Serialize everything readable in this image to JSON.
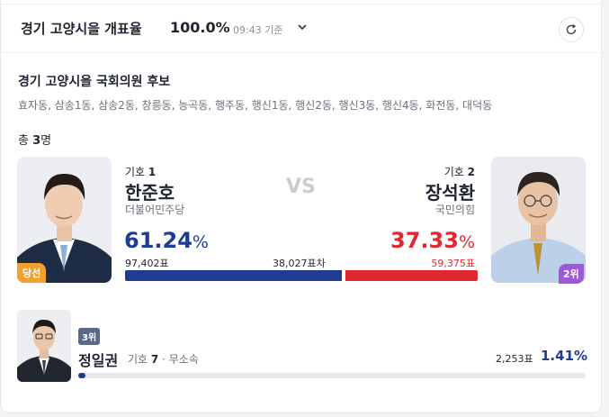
{
  "header": {
    "title": "경기 고양시을 개표율",
    "percent": "100.0%",
    "time": "09:43 기준"
  },
  "section": {
    "title": "경기 고양시을 국회의원 후보",
    "areas": "효자동, 삼송1동, 삼송2동, 창릉동, 능곡동, 행주동, 행신1동, 행신2동, 행신3동, 행신4동, 화전동, 대덕동",
    "total_prefix": "총 ",
    "total_count": "3",
    "total_suffix": "명"
  },
  "candidates": [
    {
      "number_label": "기호 ",
      "number": "1",
      "name": "한준호",
      "party": "더불어민주당",
      "percent_value": "61.24",
      "percent_unit": "%",
      "votes": "97,402표",
      "badge": "당선",
      "share": 0.6124
    },
    {
      "number_label": "기호 ",
      "number": "2",
      "name": "장석환",
      "party": "국민의힘",
      "percent_value": "37.33",
      "percent_unit": "%",
      "votes": "59,375표",
      "badge": "2위",
      "share": 0.3733
    },
    {
      "rank_badge": "3위",
      "name": "정일권",
      "number_label": "기호 ",
      "number": "7",
      "party": "· 무소속",
      "votes": "2,253표",
      "percent": "1.41%",
      "share": 0.0141
    }
  ],
  "comparison": {
    "vs": "VS",
    "difference": "38,027표차"
  },
  "icons": {
    "dropdown": "chevron-down-icon",
    "refresh": "refresh-icon"
  },
  "colors": {
    "party1": "#1d3c92",
    "party2": "#e0262f",
    "winner_badge": "#f2a12e",
    "rank2_badge": "#9b59d6"
  }
}
